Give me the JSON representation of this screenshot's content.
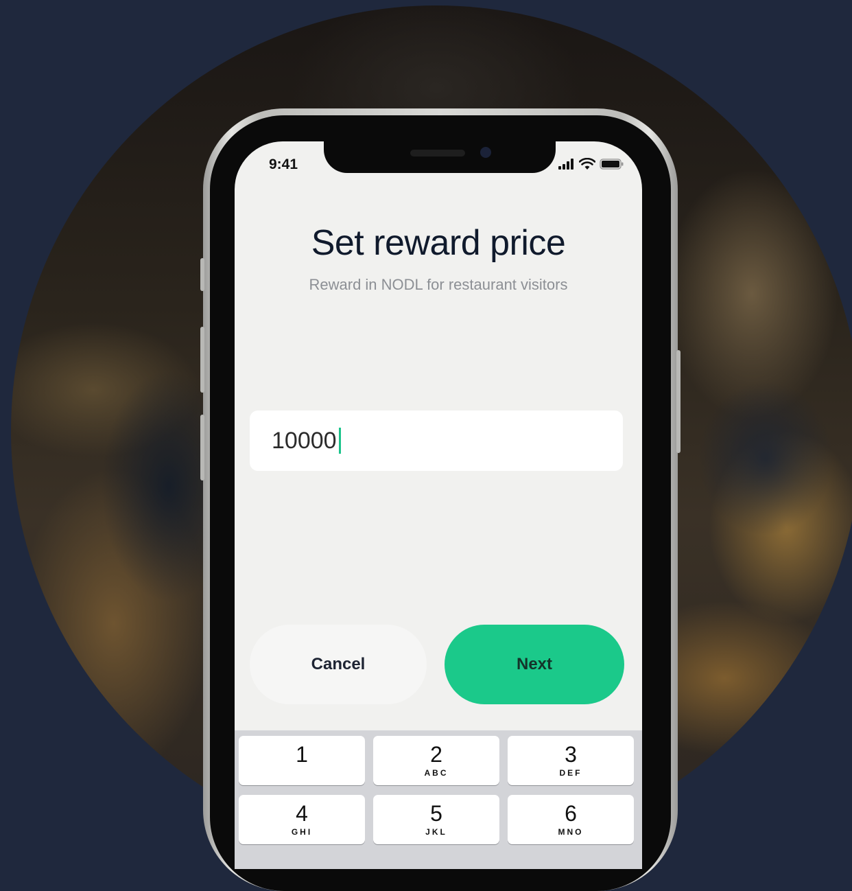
{
  "status_bar": {
    "time": "9:41"
  },
  "screen": {
    "title": "Set reward price",
    "subtitle": "Reward in NODL for restaurant visitors",
    "amount_value": "10000",
    "cancel_label": "Cancel",
    "next_label": "Next"
  },
  "keypad": [
    {
      "digit": "1",
      "letters": ""
    },
    {
      "digit": "2",
      "letters": "ABC"
    },
    {
      "digit": "3",
      "letters": "DEF"
    },
    {
      "digit": "4",
      "letters": "GHI"
    },
    {
      "digit": "5",
      "letters": "JKL"
    },
    {
      "digit": "6",
      "letters": "MNO"
    }
  ],
  "colors": {
    "accent": "#1bc98a",
    "background": "#1f283d",
    "screen_bg": "#f1f1ef",
    "caret": "#1cc48b"
  },
  "icons": [
    "signal-icon",
    "wifi-icon",
    "battery-icon"
  ]
}
